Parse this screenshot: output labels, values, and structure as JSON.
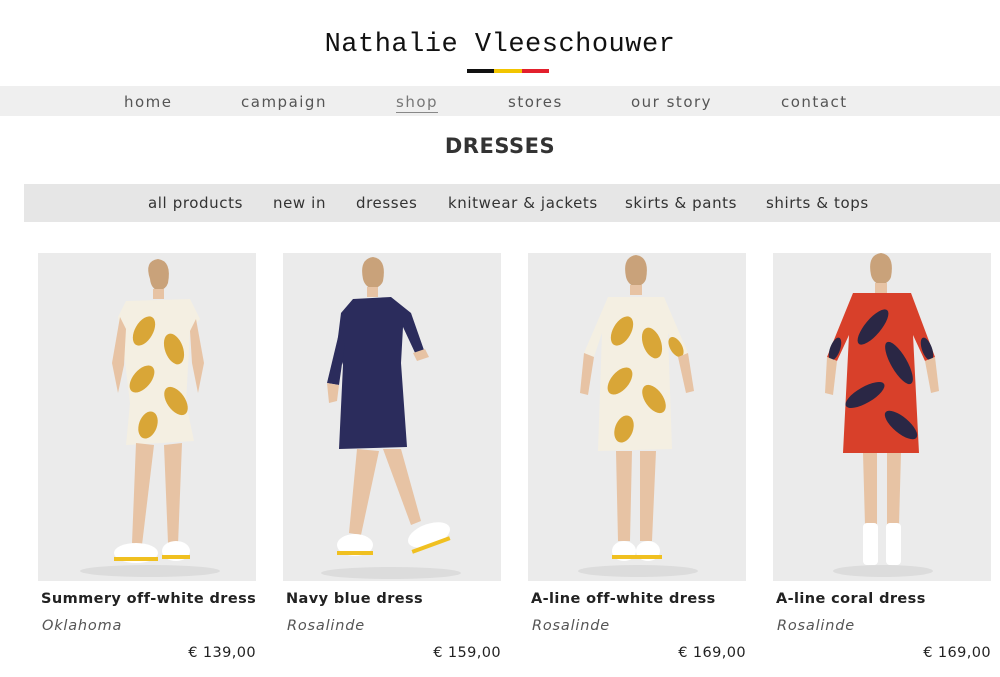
{
  "brand": {
    "name": "Nathalie Vleeschouwer",
    "flag_colors": [
      "#111111",
      "#f2c500",
      "#e3202d"
    ]
  },
  "main_nav": [
    {
      "label": "home"
    },
    {
      "label": "campaign"
    },
    {
      "label": "shop",
      "active": true
    },
    {
      "label": "stores"
    },
    {
      "label": "our story"
    },
    {
      "label": "contact"
    }
  ],
  "page": {
    "title": "DRESSES"
  },
  "category_nav": [
    {
      "label": "all products"
    },
    {
      "label": "new in"
    },
    {
      "label": "dresses"
    },
    {
      "label": "knitwear & jackets"
    },
    {
      "label": "skirts & pants"
    },
    {
      "label": "shirts & tops"
    }
  ],
  "products": [
    {
      "name": "Summery off-white dress",
      "brand": "Oklahoma",
      "price": "€ 139,00",
      "dress_color": "#f4efe2",
      "pattern_color": "#d9a637"
    },
    {
      "name": "Navy blue dress",
      "brand": "Rosalinde",
      "price": "€ 159,00",
      "dress_color": "#2b2c5c",
      "pattern_color": "#3d3f7a"
    },
    {
      "name": "A-line off-white dress",
      "brand": "Rosalinde",
      "price": "€ 169,00",
      "dress_color": "#f4efe2",
      "pattern_color": "#d9a637"
    },
    {
      "name": "A-line coral dress",
      "brand": "Rosalinde",
      "price": "€ 169,00",
      "dress_color": "#d8402a",
      "pattern_color": "#2a2745"
    }
  ]
}
